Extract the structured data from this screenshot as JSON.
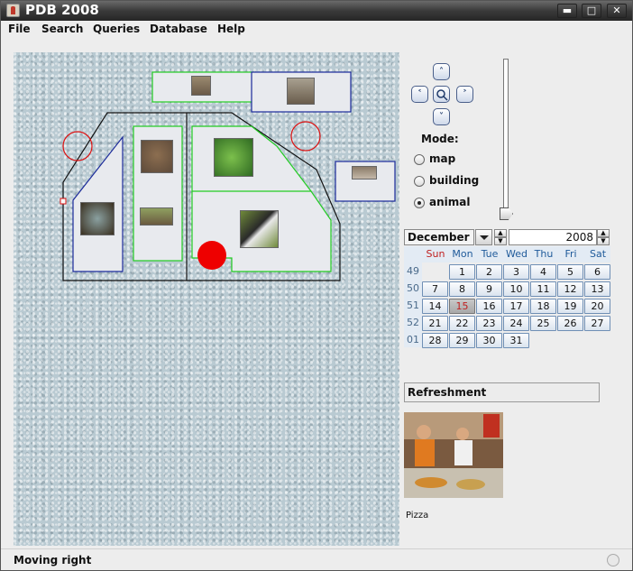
{
  "window": {
    "title": "PDB 2008",
    "minimize_icon": "minimize-icon",
    "maximize_icon": "maximize-icon",
    "close_icon": "close-icon"
  },
  "menu": {
    "items": [
      "File",
      "Search",
      "Queries",
      "Database",
      "Help"
    ]
  },
  "navigation": {
    "up": "˄",
    "left": "˂",
    "right": "˃",
    "down": "˅",
    "zoom_icon": "zoom-icon"
  },
  "mode": {
    "label": "Mode:",
    "options": [
      "map",
      "building",
      "animal"
    ],
    "selected": "animal"
  },
  "zoom_slider": {
    "level": 0.0
  },
  "calendar": {
    "month": "December",
    "year": "2008",
    "weekdays": [
      "Sun",
      "Mon",
      "Tue",
      "Wed",
      "Thu",
      "Fri",
      "Sat"
    ],
    "weeks": [
      {
        "num": "49",
        "days": [
          "",
          "1",
          "2",
          "3",
          "4",
          "5",
          "6"
        ]
      },
      {
        "num": "50",
        "days": [
          "7",
          "8",
          "9",
          "10",
          "11",
          "12",
          "13"
        ]
      },
      {
        "num": "51",
        "days": [
          "14",
          "15",
          "16",
          "17",
          "18",
          "19",
          "20"
        ]
      },
      {
        "num": "52",
        "days": [
          "21",
          "22",
          "23",
          "24",
          "25",
          "26",
          "27"
        ]
      },
      {
        "num": "01",
        "days": [
          "28",
          "29",
          "30",
          "31",
          "",
          "",
          ""
        ]
      }
    ],
    "selected_day": "15"
  },
  "refreshment": {
    "label": "Refreshment",
    "caption": "Pizza"
  },
  "status": {
    "text": "Moving right"
  },
  "colors": {
    "enclosure": "#22cc22",
    "building": "#1a2a9a",
    "outline": "#111111",
    "marker": "#e00000"
  }
}
